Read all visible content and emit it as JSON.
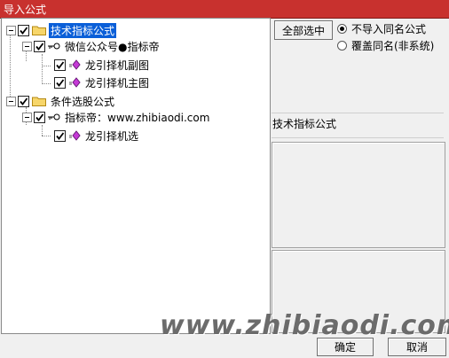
{
  "window": {
    "title": "导入公式"
  },
  "tree": {
    "root1": {
      "label": "技术指标公式"
    },
    "author1": {
      "label": "微信公众号●指标帝"
    },
    "formula_a": {
      "label": "龙引择机副图"
    },
    "formula_b": {
      "label": "龙引择机主图"
    },
    "root2": {
      "label": "条件选股公式"
    },
    "author2": {
      "label": "指标帝：www.zhibiaodi.com"
    },
    "formula_c": {
      "label": "龙引择机选"
    }
  },
  "right": {
    "select_all": "全部选中",
    "opt_no_import": "不导入同名公式",
    "opt_overwrite": "覆盖同名(非系统)",
    "section_label": "技术指标公式"
  },
  "footer": {
    "ok": "确定",
    "cancel": "取消"
  },
  "watermark": "www.zhibiaodi.com"
}
